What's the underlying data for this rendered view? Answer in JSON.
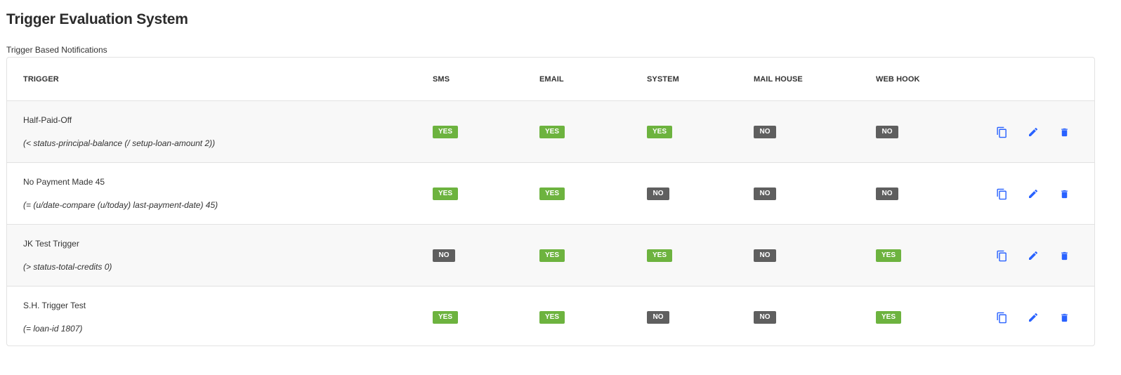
{
  "page": {
    "title": "Trigger Evaluation System",
    "section_label": "Trigger Based Notifications"
  },
  "table": {
    "headers": {
      "trigger": "TRIGGER",
      "sms": "SMS",
      "email": "EMAIL",
      "system": "SYSTEM",
      "mail_house": "MAIL HOUSE",
      "web_hook": "WEB HOOK"
    },
    "rows": [
      {
        "name": "Half-Paid-Off",
        "expression": "(< status-principal-balance (/ setup-loan-amount 2))",
        "sms": "YES",
        "email": "YES",
        "system": "YES",
        "mail_house": "NO",
        "web_hook": "NO"
      },
      {
        "name": "No Payment Made 45",
        "expression": "(= (u/date-compare (u/today) last-payment-date) 45)",
        "sms": "YES",
        "email": "YES",
        "system": "NO",
        "mail_house": "NO",
        "web_hook": "NO"
      },
      {
        "name": "JK Test Trigger",
        "expression": "(> status-total-credits 0)",
        "sms": "NO",
        "email": "YES",
        "system": "YES",
        "mail_house": "NO",
        "web_hook": "YES"
      },
      {
        "name": "S.H. Trigger Test",
        "expression": "(= loan-id 1807)",
        "sms": "YES",
        "email": "YES",
        "system": "NO",
        "mail_house": "NO",
        "web_hook": "YES"
      }
    ],
    "actions": {
      "icons": [
        "copy-icon",
        "edit-icon",
        "delete-icon"
      ]
    }
  },
  "colors": {
    "yes_badge": "#6db33f",
    "no_badge": "#5f5f5f",
    "action_icon": "#2962ff",
    "row_shade": "#f8f8f8"
  }
}
